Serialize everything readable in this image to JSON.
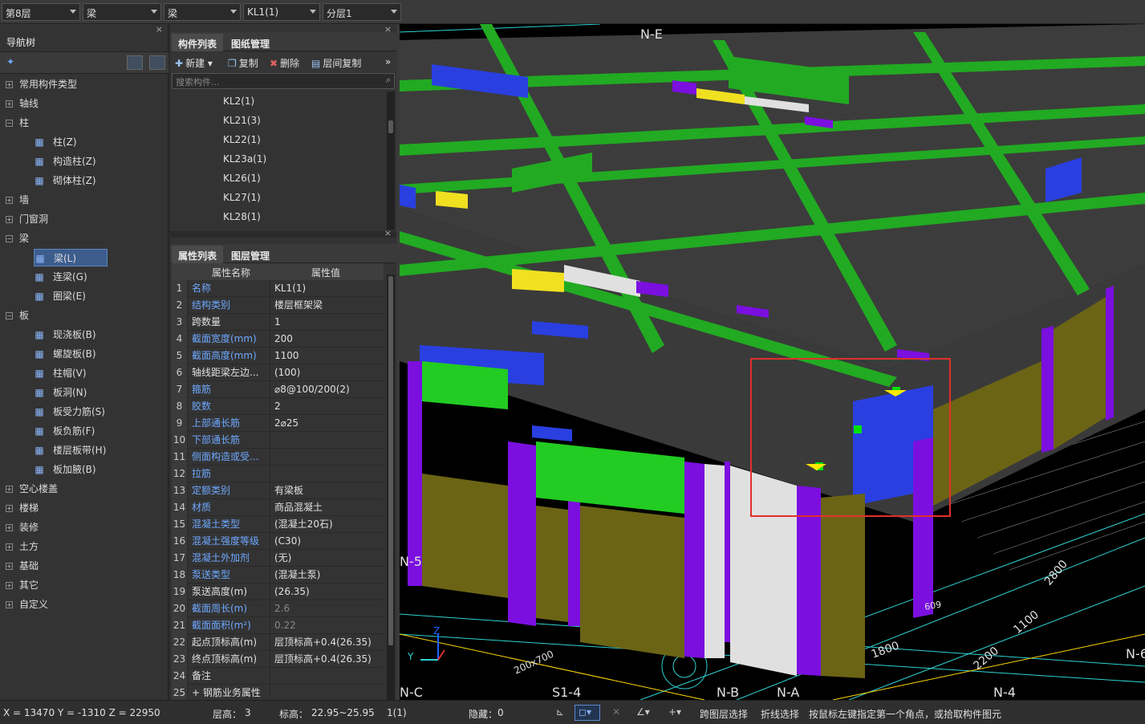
{
  "topbar": {
    "floor": "第8层",
    "type": "梁",
    "subtype": "梁",
    "component": "KL1(1)",
    "layer": "分层1"
  },
  "nav": {
    "title": "导航树",
    "close": "×",
    "nodes": [
      {
        "label": "常用构件类型",
        "expanded": false
      },
      {
        "label": "轴线",
        "expanded": false
      },
      {
        "label": "柱",
        "expanded": true,
        "children": [
          {
            "label": "柱(Z)",
            "icon": "column-icon"
          },
          {
            "label": "构造柱(Z)",
            "icon": "construct-column-icon"
          },
          {
            "label": "砌体柱(Z)",
            "icon": "masonry-column-icon"
          }
        ]
      },
      {
        "label": "墙",
        "expanded": false
      },
      {
        "label": "门窗洞",
        "expanded": false
      },
      {
        "label": "梁",
        "expanded": true,
        "children": [
          {
            "label": "梁(L)",
            "icon": "beam-icon",
            "selected": true
          },
          {
            "label": "连梁(G)",
            "icon": "link-beam-icon"
          },
          {
            "label": "圈梁(E)",
            "icon": "ring-beam-icon"
          }
        ]
      },
      {
        "label": "板",
        "expanded": true,
        "children": [
          {
            "label": "现浇板(B)",
            "icon": "slab-icon"
          },
          {
            "label": "螺旋板(B)",
            "icon": "spiral-slab-icon"
          },
          {
            "label": "柱帽(V)",
            "icon": "column-cap-icon"
          },
          {
            "label": "板洞(N)",
            "icon": "slab-hole-icon"
          },
          {
            "label": "板受力筋(S)",
            "icon": "slab-rebar-icon"
          },
          {
            "label": "板负筋(F)",
            "icon": "slab-neg-rebar-icon"
          },
          {
            "label": "楼层板带(H)",
            "icon": "slab-strip-icon"
          },
          {
            "label": "板加腋(B)",
            "icon": "slab-haunch-icon"
          }
        ]
      },
      {
        "label": "空心楼盖",
        "expanded": false
      },
      {
        "label": "楼梯",
        "expanded": false
      },
      {
        "label": "装修",
        "expanded": false
      },
      {
        "label": "土方",
        "expanded": false
      },
      {
        "label": "基础",
        "expanded": false
      },
      {
        "label": "其它",
        "expanded": false
      },
      {
        "label": "自定义",
        "expanded": false
      }
    ]
  },
  "components": {
    "tabs": [
      "构件列表",
      "图纸管理"
    ],
    "toolbar": {
      "new": "新建",
      "copy": "复制",
      "delete": "删除",
      "floor_copy": "层间复制",
      "more": "»"
    },
    "search_placeholder": "搜索构件...",
    "items": [
      "KL2(1)",
      "KL21(3)",
      "KL22(1)",
      "KL23a(1)",
      "KL26(1)",
      "KL27(1)",
      "KL28(1)"
    ]
  },
  "properties": {
    "tabs": [
      "属性列表",
      "图层管理"
    ],
    "header_name": "属性名称",
    "header_value": "属性值",
    "rows": [
      {
        "n": "1",
        "name": "名称",
        "value": "KL1(1)",
        "blue": true
      },
      {
        "n": "2",
        "name": "结构类别",
        "value": "楼层框架梁",
        "blue": true
      },
      {
        "n": "3",
        "name": "跨数量",
        "value": "1",
        "blue": false
      },
      {
        "n": "4",
        "name": "截面宽度(mm)",
        "value": "200",
        "blue": true
      },
      {
        "n": "5",
        "name": "截面高度(mm)",
        "value": "1100",
        "blue": true
      },
      {
        "n": "6",
        "name": "轴线距梁左边...",
        "value": "(100)",
        "blue": false
      },
      {
        "n": "7",
        "name": "箍筋",
        "value": "⌀8@100/200(2)",
        "blue": true
      },
      {
        "n": "8",
        "name": "胶数",
        "value": "2",
        "blue": true
      },
      {
        "n": "9",
        "name": "上部通长筋",
        "value": "2⌀25",
        "blue": true
      },
      {
        "n": "10",
        "name": "下部通长筋",
        "value": "",
        "blue": true
      },
      {
        "n": "11",
        "name": "侧面构造或受...",
        "value": "",
        "blue": true
      },
      {
        "n": "12",
        "name": "拉筋",
        "value": "",
        "blue": true
      },
      {
        "n": "13",
        "name": "定额类别",
        "value": "有梁板",
        "blue": true
      },
      {
        "n": "14",
        "name": "材质",
        "value": "商品混凝土",
        "blue": true
      },
      {
        "n": "15",
        "name": "混凝土类型",
        "value": "(混凝土20石)",
        "blue": true
      },
      {
        "n": "16",
        "name": "混凝土强度等级",
        "value": "(C30)",
        "blue": true
      },
      {
        "n": "17",
        "name": "混凝土外加剂",
        "value": "(无)",
        "blue": true
      },
      {
        "n": "18",
        "name": "泵送类型",
        "value": "(混凝土泵)",
        "blue": true
      },
      {
        "n": "19",
        "name": "泵送高度(m)",
        "value": "(26.35)",
        "blue": false
      },
      {
        "n": "20",
        "name": "截面周长(m)",
        "value": "2.6",
        "blue": true,
        "dim": true
      },
      {
        "n": "21",
        "name": "截面面积(m²)",
        "value": "0.22",
        "blue": true,
        "dim": true
      },
      {
        "n": "22",
        "name": "起点顶标高(m)",
        "value": "层顶标高+0.4(26.35)",
        "blue": false
      },
      {
        "n": "23",
        "name": "终点顶标高(m)",
        "value": "层顶标高+0.4(26.35)",
        "blue": false
      },
      {
        "n": "24",
        "name": "备注",
        "value": "",
        "blue": false
      },
      {
        "n": "25",
        "name": "+ 钢筋业务属性",
        "value": "",
        "blue": false
      }
    ]
  },
  "viewport": {
    "axis_labels": [
      "N-E",
      "N-5",
      "N-C",
      "S1-4",
      "N-B",
      "N-A",
      "N-4",
      "N-6"
    ],
    "dims": [
      "2200",
      "1100",
      "1800",
      "609",
      "2800",
      "200x700"
    ]
  },
  "status": {
    "coords": "X = 13470 Y = -1310 Z = 22950",
    "floor_height_label": "层高：",
    "floor_height": "3",
    "elevation_label": "标高：",
    "elevation": "22.95~25.95",
    "count": "1(1)",
    "hidden_label": "隐藏：",
    "hidden": "0",
    "cross_floor": "跨图层选择",
    "polyline": "折线选择",
    "hint": "按鼠标左键指定第一个角点，或拾取构件图元"
  }
}
